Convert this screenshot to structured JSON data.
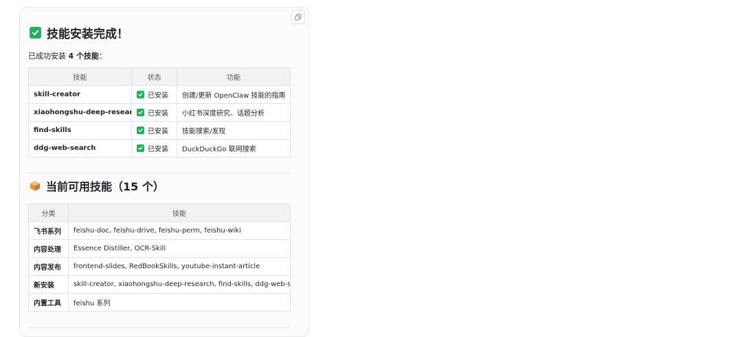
{
  "message": {
    "title": "技能安装完成！",
    "intro_prefix": "已成功安装 ",
    "intro_count": "4 个技能",
    "intro_suffix": "：",
    "installed_table": {
      "headers": [
        "技能",
        "状态",
        "功能"
      ],
      "rows": [
        {
          "skill": "skill-creator",
          "status": "已安装",
          "function": "创建/更新 OpenClaw 技能的指南"
        },
        {
          "skill": "xiaohongshu-deep-research",
          "status": "已安装",
          "function": "小红书深度研究、话题分析"
        },
        {
          "skill": "find-skills",
          "status": "已安装",
          "function": "技能搜索/发现"
        },
        {
          "skill": "ddg-web-search",
          "status": "已安装",
          "function": "DuckDuckGo 联网搜索"
        }
      ]
    },
    "section_title": "当前可用技能（15 个）",
    "available_table": {
      "headers": [
        "分类",
        "技能"
      ],
      "rows": [
        {
          "category": "飞书系列",
          "skills": "feishu-doc, feishu-drive, feishu-perm, feishu-wiki"
        },
        {
          "category": "内容处理",
          "skills": "Essence Distiller, OCR-Skill"
        },
        {
          "category": "内容发布",
          "skills": "frontend-slides, RedBookSkills, youtube-instant-article"
        },
        {
          "category": "新安装",
          "skills": "skill-creator, xiaohongshu-deep-research, find-skills, ddg-web-search"
        },
        {
          "category": "内置工具",
          "skills": "feishu 系列"
        }
      ]
    }
  },
  "icons": {
    "copy": "copy-icon",
    "check": "check-mark-icon",
    "package": "package-box-icon"
  },
  "colors": {
    "check_green": "#22b35e",
    "card_bg": "#fafafa",
    "header_bg": "#f2f2f2"
  }
}
